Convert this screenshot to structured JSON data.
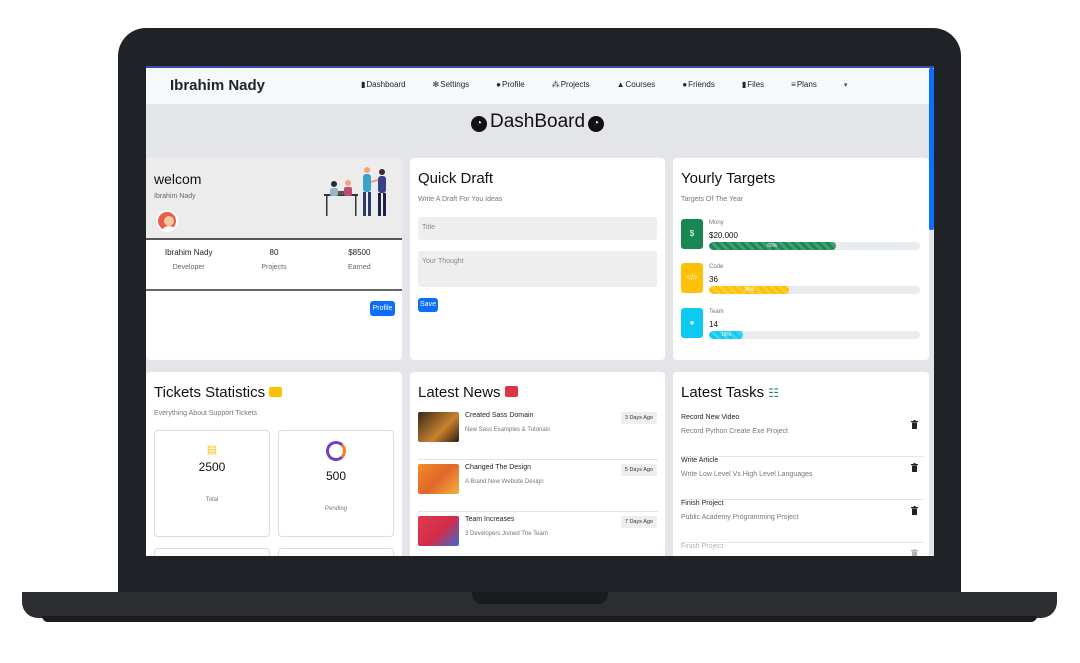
{
  "brand": "Ibrahim Nady",
  "nav": [
    {
      "label": "Dashboard",
      "icon": "chart-icon"
    },
    {
      "label": "Settings",
      "icon": "gear-icon"
    },
    {
      "label": "Profile",
      "icon": "user-icon"
    },
    {
      "label": "Projects",
      "icon": "diagram-icon"
    },
    {
      "label": "Courses",
      "icon": "graduation-cap-icon"
    },
    {
      "label": "Friends",
      "icon": "users-icon"
    },
    {
      "label": "Files",
      "icon": "file-icon"
    },
    {
      "label": "Plans",
      "icon": "layers-icon"
    }
  ],
  "page_title": "DashBoard",
  "welcome": {
    "title": "welcom",
    "name": "Ibrahim Nady",
    "stats": [
      {
        "value": "Ibrahim Nady",
        "label": "Developer"
      },
      {
        "value": "80",
        "label": "Projects"
      },
      {
        "value": "$8500",
        "label": "Earned"
      }
    ],
    "button": "Profile"
  },
  "draft": {
    "title": "Quick Draft",
    "subtitle": "Write A Draft For You Ideas",
    "title_placeholder": "Title",
    "thought_placeholder": "Your Thought",
    "button": "Save"
  },
  "targets": {
    "title": "Yourly Targets",
    "subtitle": "Targets Of The Year",
    "items": [
      {
        "label": "Mony",
        "value": "$20.000",
        "percent_text": "60%",
        "percent": 60,
        "color": "#198754",
        "icon": "dollar-icon",
        "glyph": "$"
      },
      {
        "label": "Code",
        "value": "36",
        "percent_text": "38%",
        "percent": 38,
        "color": "#ffc107",
        "icon": "code-icon",
        "glyph": "</>"
      },
      {
        "label": "Team",
        "value": "14",
        "percent_text": "16%",
        "percent": 16,
        "color": "#0dcaf0",
        "icon": "user-icon",
        "glyph": "●"
      }
    ]
  },
  "tickets": {
    "title": "Tickets Statistics",
    "subtitle": "Everything About Support Tickets",
    "boxes": [
      {
        "value": "2500",
        "label": "Total",
        "icon": "list-icon"
      },
      {
        "value": "500",
        "label": "Pending",
        "icon": "spinner-icon"
      }
    ]
  },
  "news": {
    "title": "Latest News",
    "items": [
      {
        "title": "Created Sass Domain",
        "desc": "New Sass Examples & Tutorials",
        "age": "3 Days Ago"
      },
      {
        "title": "Changed The Design",
        "desc": "A Brand New Website Design",
        "age": "5 Days Ago"
      },
      {
        "title": "Team Increases",
        "desc": "3 Developers Joined The Team",
        "age": "7 Days Ago"
      }
    ]
  },
  "tasks": {
    "title": "Latest Tasks",
    "items": [
      {
        "title": "Record New Video",
        "desc": "Record Python Create Exe Project"
      },
      {
        "title": "Write Article",
        "desc": "Write Low Level Vs High Level Languages"
      },
      {
        "title": "Finish Project",
        "desc": "Public Academy Programming Project"
      },
      {
        "title": "Finish Project",
        "desc": ""
      }
    ]
  },
  "colors": {
    "primary": "#0d6efd",
    "success": "#198754",
    "warning": "#ffc107",
    "info": "#0dcaf0",
    "danger": "#dc3545"
  }
}
